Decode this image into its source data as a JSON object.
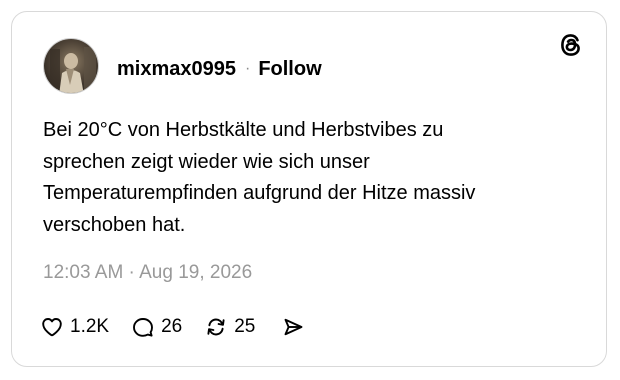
{
  "post": {
    "username": "mixmax0995",
    "separator": "·",
    "follow_label": "Follow",
    "text_lines": [
      "Bei 20°C von Herbstkälte und Herbstvibes zu",
      "sprechen zeigt wieder wie sich unser",
      "Temperaturempfinden aufgrund der Hitze massiv",
      "verschoben hat."
    ],
    "timestamp": "12:03 AM · Aug 19, 2026"
  },
  "actions": {
    "likes": "1.2K",
    "replies": "26",
    "reposts": "25"
  },
  "icons": {
    "brand": "threads-logo-icon",
    "like": "heart-icon",
    "reply": "comment-bubble-icon",
    "repost": "repost-icon",
    "share": "send-icon"
  },
  "colors": {
    "text": "#000000",
    "muted": "#999999",
    "border": "#d9d9d9"
  }
}
